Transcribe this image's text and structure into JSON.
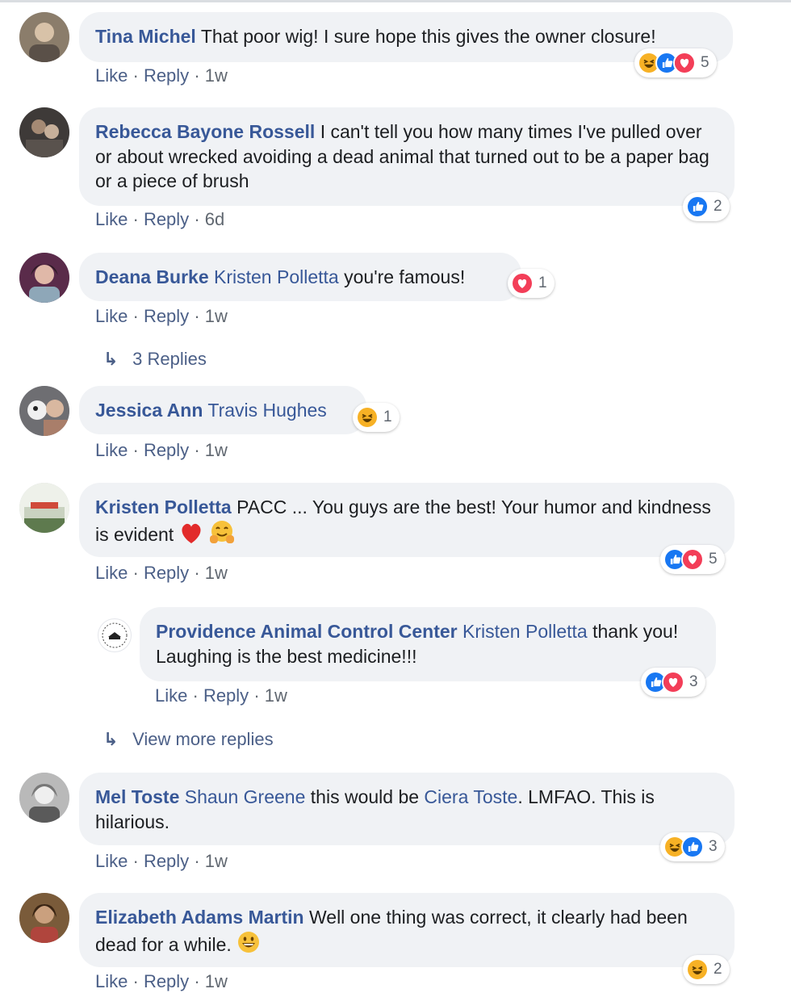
{
  "comments": [
    {
      "author": "Tina Michel",
      "text": "That poor wig! I sure hope this gives the owner closure!",
      "actions": {
        "like": "Like",
        "reply": "Reply",
        "time": "1w"
      },
      "reactions": {
        "icons": [
          "haha-icon",
          "like-icon",
          "love-icon"
        ],
        "count": "5"
      }
    },
    {
      "author": "Rebecca Bayone Rossell",
      "text": "I can't tell you how many times I've pulled over or about wrecked avoiding a dead animal that turned out to be a paper bag or a piece of brush",
      "actions": {
        "like": "Like",
        "reply": "Reply",
        "time": "6d"
      },
      "reactions": {
        "icons": [
          "like-icon"
        ],
        "count": "2"
      }
    },
    {
      "author": "Deana Burke",
      "mention": "Kristen Polletta",
      "text": "you're famous!",
      "actions": {
        "like": "Like",
        "reply": "Reply",
        "time": "1w"
      },
      "reactions": {
        "icons": [
          "love-icon"
        ],
        "count": "1"
      },
      "replies_link": "3 Replies"
    },
    {
      "author": "Jessica Ann",
      "mention": "Travis Hughes",
      "text": "",
      "actions": {
        "like": "Like",
        "reply": "Reply",
        "time": "1w"
      },
      "reactions": {
        "icons": [
          "haha-icon"
        ],
        "count": "1"
      }
    },
    {
      "author": "Kristen Polletta",
      "text": "PACC ... You guys are the best! Your humor and kindness is evident",
      "emojis": [
        "red-heart-icon",
        "hugging-face-icon"
      ],
      "actions": {
        "like": "Like",
        "reply": "Reply",
        "time": "1w"
      },
      "reactions": {
        "icons": [
          "like-icon",
          "love-icon"
        ],
        "count": "5"
      },
      "reply": {
        "author": "Providence Animal Control Center",
        "mention": "Kristen Polletta",
        "text": "thank you! Laughing is the best medicine!!!",
        "actions": {
          "like": "Like",
          "reply": "Reply",
          "time": "1w"
        },
        "reactions": {
          "icons": [
            "like-icon",
            "love-icon"
          ],
          "count": "3"
        }
      },
      "more_link": "View more replies"
    },
    {
      "author": "Mel Toste",
      "mention1": "Shaun Greene",
      "text1": "this would be",
      "mention2": "Ciera Toste",
      "text2": ". LMFAO. This is hilarious.",
      "actions": {
        "like": "Like",
        "reply": "Reply",
        "time": "1w"
      },
      "reactions": {
        "icons": [
          "haha-icon",
          "like-icon"
        ],
        "count": "3"
      }
    },
    {
      "author": "Elizabeth Adams Martin",
      "text": "Well one thing was correct, it clearly had been dead for a while.",
      "emojis": [
        "grinning-face-icon"
      ],
      "actions": {
        "like": "Like",
        "reply": "Reply",
        "time": "1w"
      },
      "reactions": {
        "icons": [
          "haha-icon"
        ],
        "count": "2"
      }
    }
  ],
  "colors": {
    "author": "#385898",
    "bubble": "#f0f2f5",
    "link": "#4b5f87",
    "like": "#1877f2",
    "love": "#f33e58",
    "haha": "#f7b125"
  }
}
